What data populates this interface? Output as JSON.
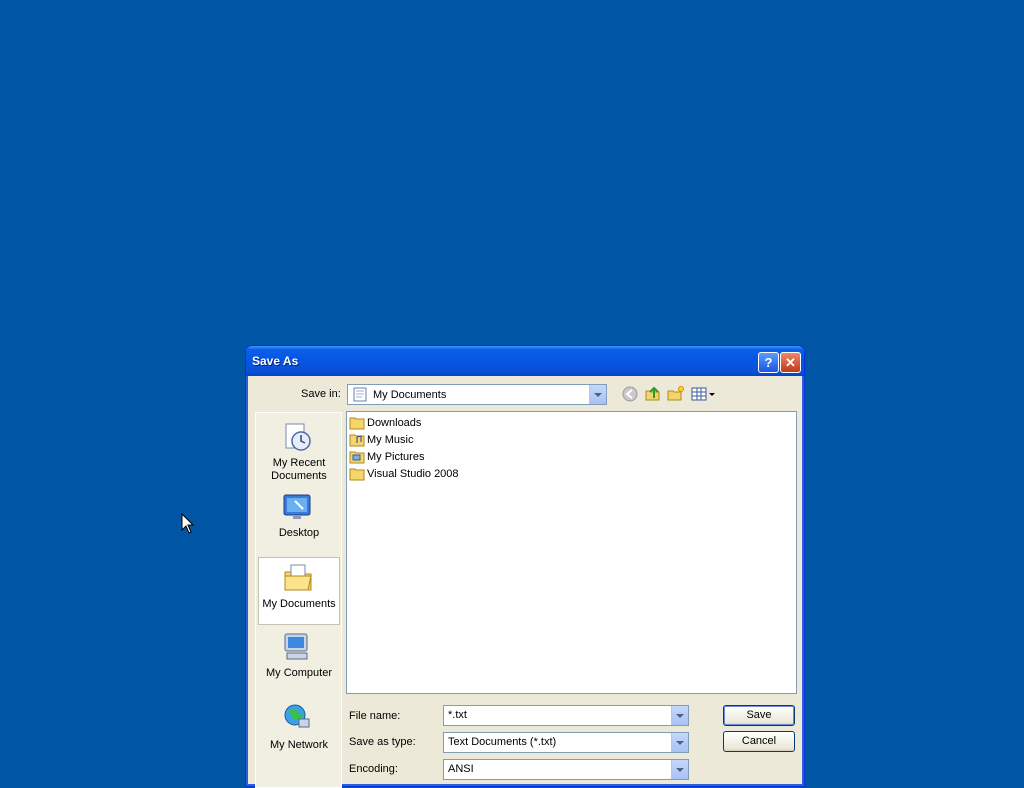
{
  "desktop": {
    "background": "#0055a5"
  },
  "dialog": {
    "title": "Save As",
    "help_glyph": "?",
    "close_glyph": "✕",
    "save_in": {
      "label": "Save in:",
      "value": "My Documents"
    },
    "places": [
      {
        "label": "My Recent Documents",
        "icon": "recent-documents-icon"
      },
      {
        "label": "Desktop",
        "icon": "desktop-icon"
      },
      {
        "label": "My Documents",
        "icon": "my-documents-icon",
        "selected": true
      },
      {
        "label": "My Computer",
        "icon": "my-computer-icon"
      },
      {
        "label": "My Network",
        "icon": "my-network-icon"
      }
    ],
    "files": [
      {
        "name": "Downloads",
        "icon": "folder-icon"
      },
      {
        "name": "My Music",
        "icon": "music-folder-icon"
      },
      {
        "name": "My Pictures",
        "icon": "pictures-folder-icon"
      },
      {
        "name": "Visual Studio 2008",
        "icon": "folder-icon"
      }
    ],
    "file_name": {
      "label": "File name:",
      "value": "*.txt"
    },
    "save_as_type": {
      "label": "Save as type:",
      "value": "Text Documents (*.txt)"
    },
    "encoding": {
      "label": "Encoding:",
      "value": "ANSI"
    },
    "buttons": {
      "save": "Save",
      "cancel": "Cancel"
    }
  }
}
